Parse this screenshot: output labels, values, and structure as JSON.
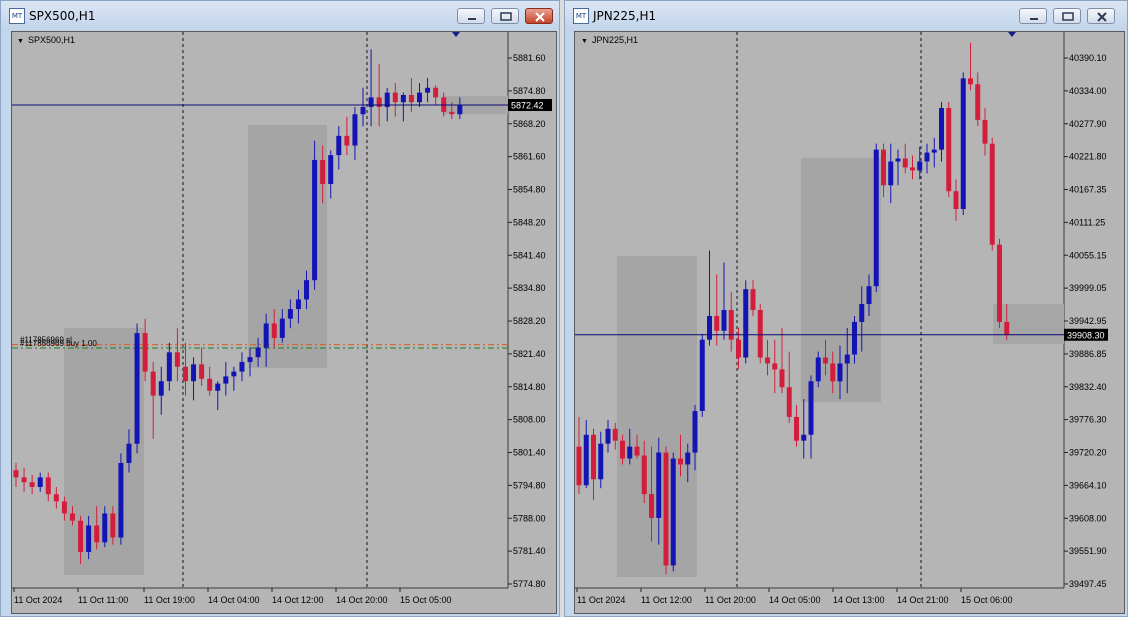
{
  "windows": [
    {
      "id": "spx",
      "title": "SPX500,H1",
      "chart_label": "SPX500,H1",
      "close_active": true,
      "price_label": "5872.42",
      "order_labels": [
        "#117856969 sl",
        "#117856969 buy 1.00"
      ],
      "colors": {
        "bull": "#1414b4",
        "bear": "#d21e3c",
        "price_line": "#0a0a78",
        "sl_line": "#e05a28",
        "buy_line": "#1e7a1e"
      }
    },
    {
      "id": "jpn",
      "title": "JPN225,H1",
      "chart_label": "JPN225,H1",
      "close_active": false,
      "price_label": "39908.30",
      "order_labels": [],
      "colors": {
        "bull": "#1414b4",
        "bear": "#d21e3c",
        "price_line": "#0a0a78"
      }
    }
  ],
  "chart_data": [
    {
      "type": "candlestick",
      "symbol": "SPX500",
      "timeframe": "H1",
      "y_ticks": [
        "5881.60",
        "5874.80",
        "5868.20",
        "5861.60",
        "5854.80",
        "5848.20",
        "5841.40",
        "5834.80",
        "5828.20",
        "5821.40",
        "5814.80",
        "5808.00",
        "5801.40",
        "5794.80",
        "5788.00",
        "5781.40",
        "5774.80"
      ],
      "x_ticks": [
        "11 Oct 2024",
        "11 Oct 11:00",
        "11 Oct 19:00",
        "14 Oct 04:00",
        "14 Oct 12:00",
        "14 Oct 20:00",
        "15 Oct 05:00"
      ],
      "ylim": [
        5772.0,
        5887.6
      ],
      "current_price": 5872.42,
      "sl_price": 5822.6,
      "buy_price": 5821.9,
      "candles": [
        [
          5796.5,
          5798.0,
          5793.0,
          5795.0
        ],
        [
          5795.0,
          5797.0,
          5792.0,
          5794.0
        ],
        [
          5794.0,
          5795.5,
          5791.5,
          5793.0
        ],
        [
          5793.0,
          5796.0,
          5792.0,
          5795.0
        ],
        [
          5795.0,
          5796.0,
          5790.0,
          5791.5
        ],
        [
          5791.5,
          5793.0,
          5788.5,
          5790.0
        ],
        [
          5790.0,
          5791.0,
          5786.0,
          5787.5
        ],
        [
          5787.5,
          5789.0,
          5785.0,
          5786.0
        ],
        [
          5786.0,
          5787.0,
          5777.0,
          5779.5
        ],
        [
          5779.5,
          5787.0,
          5778.0,
          5785.0
        ],
        [
          5785.0,
          5789.0,
          5780.0,
          5781.5
        ],
        [
          5781.5,
          5789.0,
          5780.5,
          5787.5
        ],
        [
          5787.5,
          5789.0,
          5781.0,
          5782.5
        ],
        [
          5782.5,
          5800.0,
          5781.0,
          5798.0
        ],
        [
          5798.0,
          5805.0,
          5796.0,
          5802.0
        ],
        [
          5802.0,
          5827.0,
          5800.0,
          5825.0
        ],
        [
          5825.0,
          5828.0,
          5815.0,
          5817.0
        ],
        [
          5817.0,
          5819.0,
          5803.0,
          5812.0
        ],
        [
          5812.0,
          5818.0,
          5808.0,
          5815.0
        ],
        [
          5815.0,
          5823.0,
          5813.0,
          5821.0
        ],
        [
          5821.0,
          5826.0,
          5815.0,
          5818.0
        ],
        [
          5818.0,
          5823.0,
          5812.0,
          5815.0
        ],
        [
          5815.0,
          5820.0,
          5811.0,
          5818.5
        ],
        [
          5818.5,
          5822.0,
          5814.0,
          5815.5
        ],
        [
          5815.5,
          5818.0,
          5812.0,
          5813.0
        ],
        [
          5813.0,
          5815.0,
          5809.0,
          5814.5
        ],
        [
          5814.5,
          5819.0,
          5812.0,
          5816.0
        ],
        [
          5816.0,
          5818.0,
          5813.0,
          5817.0
        ],
        [
          5817.0,
          5821.0,
          5815.0,
          5819.0
        ],
        [
          5819.0,
          5822.0,
          5816.0,
          5820.0
        ],
        [
          5820.0,
          5824.0,
          5818.0,
          5822.0
        ],
        [
          5822.0,
          5829.0,
          5818.0,
          5827.0
        ],
        [
          5827.0,
          5830.0,
          5822.0,
          5824.0
        ],
        [
          5824.0,
          5830.0,
          5823.0,
          5828.0
        ],
        [
          5828.0,
          5832.0,
          5826.0,
          5830.0
        ],
        [
          5830.0,
          5834.0,
          5827.0,
          5832.0
        ],
        [
          5832.0,
          5838.0,
          5830.0,
          5836.0
        ],
        [
          5836.0,
          5865.0,
          5834.0,
          5861.0
        ],
        [
          5861.0,
          5864.0,
          5852.0,
          5856.0
        ],
        [
          5856.0,
          5863.0,
          5853.0,
          5862.0
        ],
        [
          5862.0,
          5868.0,
          5859.0,
          5866.0
        ],
        [
          5866.0,
          5870.0,
          5862.0,
          5864.0
        ],
        [
          5864.0,
          5872.0,
          5861.0,
          5870.5
        ],
        [
          5870.5,
          5876.0,
          5868.0,
          5872.0
        ],
        [
          5872.0,
          5884.0,
          5868.0,
          5874.0
        ],
        [
          5874.0,
          5881.0,
          5868.0,
          5872.0
        ],
        [
          5872.0,
          5876.0,
          5869.0,
          5875.0
        ],
        [
          5875.0,
          5877.0,
          5870.0,
          5873.0
        ],
        [
          5873.0,
          5875.0,
          5869.0,
          5874.5
        ],
        [
          5874.5,
          5878.0,
          5871.0,
          5873.0
        ],
        [
          5873.0,
          5877.0,
          5872.0,
          5875.0
        ],
        [
          5875.0,
          5878.0,
          5873.0,
          5876.0
        ],
        [
          5876.0,
          5876.5,
          5872.5,
          5874.0
        ],
        [
          5874.0,
          5875.0,
          5870.0,
          5871.0
        ],
        [
          5871.0,
          5873.0,
          5869.5,
          5870.5
        ],
        [
          5870.5,
          5874.0,
          5869.5,
          5872.4
        ]
      ]
    },
    {
      "type": "candlestick",
      "symbol": "JPN225",
      "timeframe": "H1",
      "y_ticks": [
        "40390.10",
        "40334.00",
        "40277.90",
        "40221.80",
        "40167.35",
        "40111.25",
        "40055.15",
        "39999.05",
        "39942.95",
        "39886.85",
        "39832.40",
        "39776.30",
        "39720.20",
        "39664.10",
        "39608.00",
        "39551.90",
        "39497.45"
      ],
      "x_ticks": [
        "11 Oct 2024",
        "11 Oct 12:00",
        "11 Oct 20:00",
        "14 Oct 05:00",
        "14 Oct 13:00",
        "14 Oct 21:00",
        "15 Oct 06:00"
      ],
      "ylim": [
        39482.0,
        40418.0
      ],
      "current_price": 39908.3,
      "candles": [
        [
          39720,
          39770,
          39640,
          39655
        ],
        [
          39655,
          39765,
          39650,
          39740
        ],
        [
          39740,
          39750,
          39630,
          39665
        ],
        [
          39665,
          39745,
          39650,
          39725
        ],
        [
          39725,
          39765,
          39710,
          39750
        ],
        [
          39750,
          39760,
          39715,
          39730
        ],
        [
          39730,
          39740,
          39690,
          39700
        ],
        [
          39700,
          39750,
          39690,
          39720
        ],
        [
          39720,
          39740,
          39700,
          39705
        ],
        [
          39705,
          39730,
          39625,
          39640
        ],
        [
          39640,
          39720,
          39560,
          39600
        ],
        [
          39600,
          39735,
          39555,
          39710
        ],
        [
          39710,
          39720,
          39505,
          39520
        ],
        [
          39520,
          39710,
          39510,
          39700
        ],
        [
          39700,
          39740,
          39670,
          39690
        ],
        [
          39690,
          39725,
          39660,
          39710
        ],
        [
          39710,
          39790,
          39680,
          39780
        ],
        [
          39780,
          39910,
          39770,
          39900
        ],
        [
          39900,
          40050,
          39890,
          39940
        ],
        [
          39940,
          40010,
          39890,
          39915
        ],
        [
          39915,
          40030,
          39900,
          39950
        ],
        [
          39950,
          39980,
          39880,
          39900
        ],
        [
          39900,
          39920,
          39850,
          39870
        ],
        [
          39870,
          40000,
          39860,
          39985
        ],
        [
          39985,
          40000,
          39940,
          39950
        ],
        [
          39950,
          39960,
          39860,
          39870
        ],
        [
          39870,
          39900,
          39840,
          39860
        ],
        [
          39860,
          39900,
          39810,
          39850
        ],
        [
          39850,
          39920,
          39810,
          39820
        ],
        [
          39820,
          39880,
          39760,
          39770
        ],
        [
          39770,
          39790,
          39720,
          39730
        ],
        [
          39730,
          39800,
          39700,
          39740
        ],
        [
          39740,
          39840,
          39700,
          39830
        ],
        [
          39830,
          39880,
          39820,
          39870
        ],
        [
          39870,
          39900,
          39840,
          39860
        ],
        [
          39860,
          39880,
          39810,
          39830
        ],
        [
          39830,
          39890,
          39800,
          39860
        ],
        [
          39860,
          39920,
          39810,
          39875
        ],
        [
          39875,
          39940,
          39860,
          39930
        ],
        [
          39930,
          39990,
          39880,
          39960
        ],
        [
          39960,
          40010,
          39940,
          39990
        ],
        [
          39990,
          40230,
          39980,
          40220
        ],
        [
          40220,
          40230,
          40140,
          40160
        ],
        [
          40160,
          40230,
          40130,
          40200
        ],
        [
          40200,
          40220,
          40160,
          40205
        ],
        [
          40205,
          40230,
          40180,
          40190
        ],
        [
          40190,
          40210,
          40170,
          40185
        ],
        [
          40185,
          40225,
          40170,
          40200
        ],
        [
          40200,
          40230,
          40180,
          40215
        ],
        [
          40215,
          40240,
          40190,
          40220
        ],
        [
          40220,
          40300,
          40200,
          40290
        ],
        [
          40290,
          40300,
          40140,
          40150
        ],
        [
          40150,
          40170,
          40100,
          40120
        ],
        [
          40120,
          40350,
          40110,
          40340
        ],
        [
          40340,
          40400,
          40320,
          40330
        ],
        [
          40330,
          40350,
          40260,
          40270
        ],
        [
          40270,
          40290,
          40210,
          40230
        ],
        [
          40230,
          40240,
          40050,
          40060
        ],
        [
          40060,
          40070,
          39920,
          39930
        ],
        [
          39930,
          39960,
          39900,
          39908
        ]
      ]
    }
  ]
}
